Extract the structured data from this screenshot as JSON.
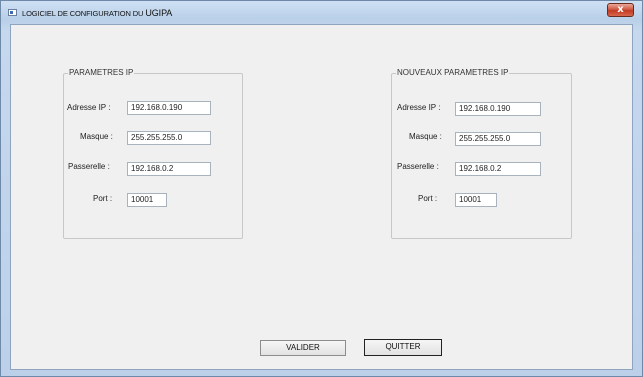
{
  "window": {
    "title_prefix": "LOGICIEL DE CONFIGURATION DU ",
    "title_name": "UGIPA",
    "close_label": "x"
  },
  "left_group": {
    "legend": "PARAMETRES IP",
    "ip_label": "Adresse IP :",
    "ip_value": "192.168.0.190",
    "mask_label": "Masque :",
    "mask_value": "255.255.255.0",
    "gateway_label": "Passerelle :",
    "gateway_value": "192.168.0.2",
    "port_label": "Port :",
    "port_value": "10001"
  },
  "right_group": {
    "legend": "NOUVEAUX PARAMETRES IP",
    "ip_label": "Adresse IP :",
    "ip_value": "192.168.0.190",
    "mask_label": "Masque :",
    "mask_value": "255.255.255.0",
    "gateway_label": "Passerelle :",
    "gateway_value": "192.168.0.2",
    "port_label": "Port :",
    "port_value": "10001"
  },
  "buttons": {
    "validate": "VALIDER",
    "quit": "QUITTER"
  }
}
